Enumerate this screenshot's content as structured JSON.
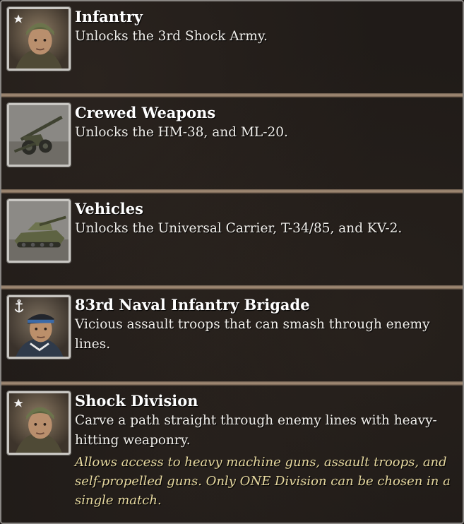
{
  "entries": [
    {
      "icon": "infantry-soldier-portrait-icon",
      "title": "Infantry",
      "desc": "Unlocks the 3rd Shock Army."
    },
    {
      "icon": "artillery-gun-portrait-icon",
      "title": "Crewed Weapons",
      "desc": "Unlocks the HM-38, and ML-20."
    },
    {
      "icon": "tank-portrait-icon",
      "title": "Vehicles",
      "desc": "Unlocks the Universal Carrier, T-34/85, and KV-2."
    },
    {
      "icon": "naval-infantry-portrait-icon",
      "title": "83rd Naval Infantry Brigade",
      "desc": "Vicious assault troops that can smash through enemy lines."
    },
    {
      "icon": "shock-division-portrait-icon",
      "title": "Shock Division",
      "desc": "Carve a path straight through enemy lines with heavy-hitting weaponry.",
      "note": "Allows access to heavy machine guns, assault troops, and self-propelled guns. Only ONE Division can be chosen in a single match."
    }
  ],
  "colors": {
    "background": "#201b18",
    "separator": "#a8917a",
    "title": "#ffffff",
    "note": "#e7d9a0"
  }
}
